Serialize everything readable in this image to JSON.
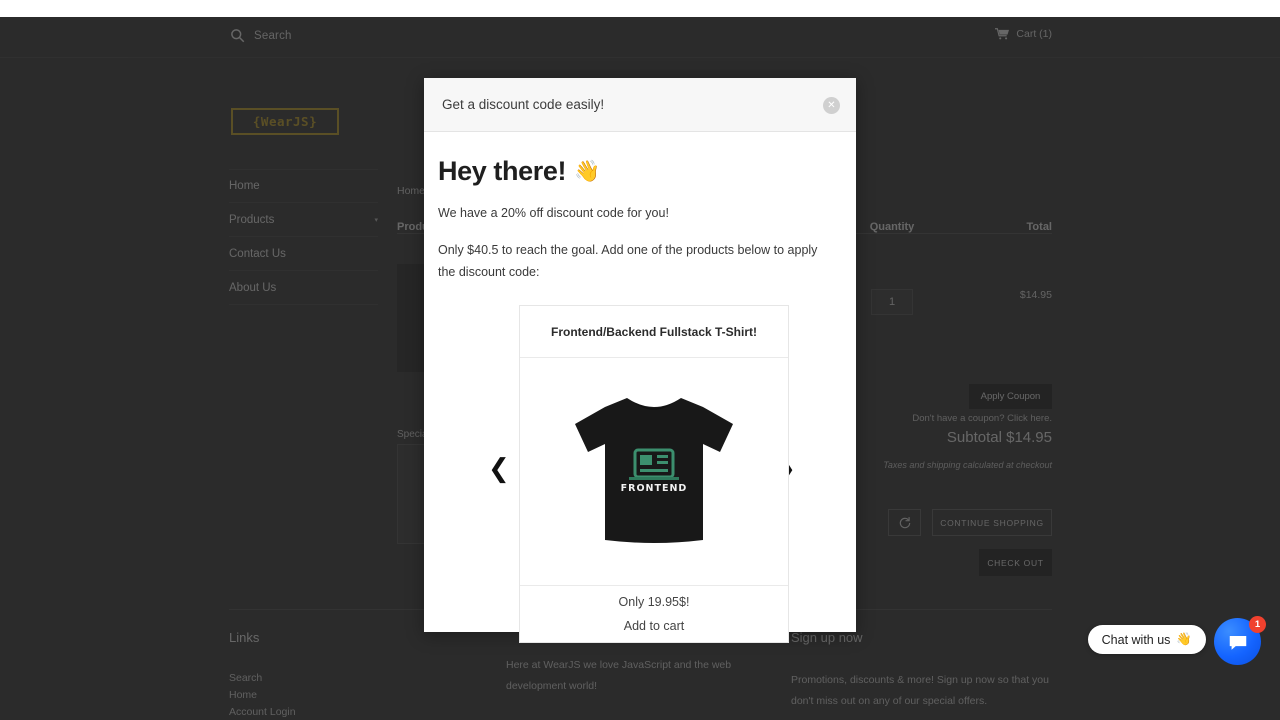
{
  "topbar": {
    "search_icon": "search-icon",
    "search_label": "Search",
    "cart_icon": "cart-icon",
    "cart_label": "Cart (1)"
  },
  "brand": {
    "logo_text": "{WearJS}"
  },
  "sidebar": {
    "items": [
      {
        "label": "Home",
        "has_caret": false
      },
      {
        "label": "Products",
        "has_caret": true
      },
      {
        "label": "Contact Us",
        "has_caret": false
      },
      {
        "label": "About Us",
        "has_caret": false
      }
    ]
  },
  "cart": {
    "breadcrumb": "Home",
    "columns": {
      "product": "Product",
      "quantity": "Quantity",
      "total": "Total"
    },
    "row": {
      "quantity": "1",
      "total": "$14.95"
    },
    "special_label": "Special instructions for seller",
    "apply_coupon": "Apply Coupon",
    "coupon_link": "Don't have a coupon? Click here.",
    "subtotal": "Subtotal $14.95",
    "tax_note": "Taxes and shipping calculated at checkout",
    "refresh_icon": "refresh-icon",
    "continue_shopping": "CONTINUE SHOPPING",
    "check_out": "CHECK OUT"
  },
  "footer": {
    "col1": {
      "heading": "Links",
      "links": [
        "Search",
        "Home",
        "Account Login"
      ]
    },
    "col2": {
      "body": "Here at WearJS we love JavaScript and the web development world!"
    },
    "col3": {
      "heading": "Sign up now",
      "body": "Promotions, discounts & more! Sign up now so that you don't miss out on any of our special offers."
    }
  },
  "modal": {
    "title": "Get a discount code easily!",
    "close_icon": "close-icon",
    "heading": "Hey there!",
    "wave_emoji": "👋",
    "line1": "We have a 20% off discount code for you!",
    "line2": "Only $40.5 to reach the goal. Add one of the products below to apply the discount code:",
    "carousel": {
      "prev_icon": "chevron-left-icon",
      "next_icon": "chevron-right-icon",
      "product": {
        "title": "Frontend/Backend Fullstack T-Shirt!",
        "shirt_graphic_label": "FRONTEND",
        "shirt_color": "#181818",
        "graphic_color": "#3c8f6e",
        "price": "Only 19.95$!",
        "add_to_cart": "Add to cart"
      }
    }
  },
  "chat": {
    "pill_text": "Chat with us",
    "pill_emoji": "👋",
    "button_icon": "chat-bubble-icon",
    "badge_count": "1",
    "badge_color": "#f0412e",
    "button_color": "#1464ff"
  }
}
